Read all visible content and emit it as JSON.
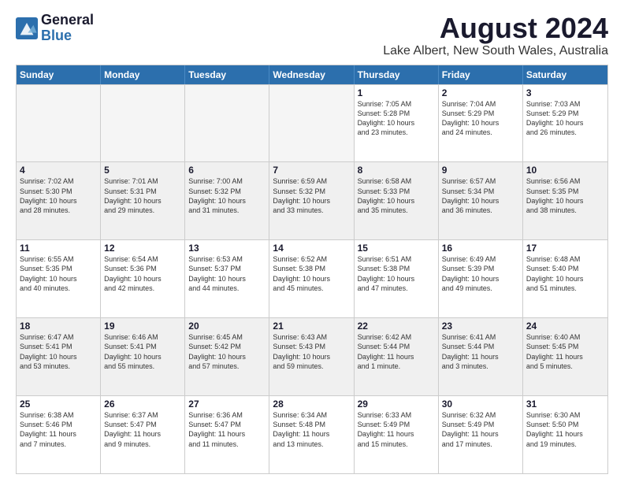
{
  "header": {
    "logo_general": "General",
    "logo_blue": "Blue",
    "title": "August 2024",
    "subtitle": "Lake Albert, New South Wales, Australia"
  },
  "weekdays": [
    "Sunday",
    "Monday",
    "Tuesday",
    "Wednesday",
    "Thursday",
    "Friday",
    "Saturday"
  ],
  "rows": [
    [
      {
        "day": "",
        "empty": true
      },
      {
        "day": "",
        "empty": true
      },
      {
        "day": "",
        "empty": true
      },
      {
        "day": "",
        "empty": true
      },
      {
        "day": "1",
        "info": "Sunrise: 7:05 AM\nSunset: 5:28 PM\nDaylight: 10 hours\nand 23 minutes."
      },
      {
        "day": "2",
        "info": "Sunrise: 7:04 AM\nSunset: 5:29 PM\nDaylight: 10 hours\nand 24 minutes."
      },
      {
        "day": "3",
        "info": "Sunrise: 7:03 AM\nSunset: 5:29 PM\nDaylight: 10 hours\nand 26 minutes."
      }
    ],
    [
      {
        "day": "4",
        "info": "Sunrise: 7:02 AM\nSunset: 5:30 PM\nDaylight: 10 hours\nand 28 minutes."
      },
      {
        "day": "5",
        "info": "Sunrise: 7:01 AM\nSunset: 5:31 PM\nDaylight: 10 hours\nand 29 minutes."
      },
      {
        "day": "6",
        "info": "Sunrise: 7:00 AM\nSunset: 5:32 PM\nDaylight: 10 hours\nand 31 minutes."
      },
      {
        "day": "7",
        "info": "Sunrise: 6:59 AM\nSunset: 5:32 PM\nDaylight: 10 hours\nand 33 minutes."
      },
      {
        "day": "8",
        "info": "Sunrise: 6:58 AM\nSunset: 5:33 PM\nDaylight: 10 hours\nand 35 minutes."
      },
      {
        "day": "9",
        "info": "Sunrise: 6:57 AM\nSunset: 5:34 PM\nDaylight: 10 hours\nand 36 minutes."
      },
      {
        "day": "10",
        "info": "Sunrise: 6:56 AM\nSunset: 5:35 PM\nDaylight: 10 hours\nand 38 minutes."
      }
    ],
    [
      {
        "day": "11",
        "info": "Sunrise: 6:55 AM\nSunset: 5:35 PM\nDaylight: 10 hours\nand 40 minutes."
      },
      {
        "day": "12",
        "info": "Sunrise: 6:54 AM\nSunset: 5:36 PM\nDaylight: 10 hours\nand 42 minutes."
      },
      {
        "day": "13",
        "info": "Sunrise: 6:53 AM\nSunset: 5:37 PM\nDaylight: 10 hours\nand 44 minutes."
      },
      {
        "day": "14",
        "info": "Sunrise: 6:52 AM\nSunset: 5:38 PM\nDaylight: 10 hours\nand 45 minutes."
      },
      {
        "day": "15",
        "info": "Sunrise: 6:51 AM\nSunset: 5:38 PM\nDaylight: 10 hours\nand 47 minutes."
      },
      {
        "day": "16",
        "info": "Sunrise: 6:49 AM\nSunset: 5:39 PM\nDaylight: 10 hours\nand 49 minutes."
      },
      {
        "day": "17",
        "info": "Sunrise: 6:48 AM\nSunset: 5:40 PM\nDaylight: 10 hours\nand 51 minutes."
      }
    ],
    [
      {
        "day": "18",
        "info": "Sunrise: 6:47 AM\nSunset: 5:41 PM\nDaylight: 10 hours\nand 53 minutes."
      },
      {
        "day": "19",
        "info": "Sunrise: 6:46 AM\nSunset: 5:41 PM\nDaylight: 10 hours\nand 55 minutes."
      },
      {
        "day": "20",
        "info": "Sunrise: 6:45 AM\nSunset: 5:42 PM\nDaylight: 10 hours\nand 57 minutes."
      },
      {
        "day": "21",
        "info": "Sunrise: 6:43 AM\nSunset: 5:43 PM\nDaylight: 10 hours\nand 59 minutes."
      },
      {
        "day": "22",
        "info": "Sunrise: 6:42 AM\nSunset: 5:44 PM\nDaylight: 11 hours\nand 1 minute."
      },
      {
        "day": "23",
        "info": "Sunrise: 6:41 AM\nSunset: 5:44 PM\nDaylight: 11 hours\nand 3 minutes."
      },
      {
        "day": "24",
        "info": "Sunrise: 6:40 AM\nSunset: 5:45 PM\nDaylight: 11 hours\nand 5 minutes."
      }
    ],
    [
      {
        "day": "25",
        "info": "Sunrise: 6:38 AM\nSunset: 5:46 PM\nDaylight: 11 hours\nand 7 minutes."
      },
      {
        "day": "26",
        "info": "Sunrise: 6:37 AM\nSunset: 5:47 PM\nDaylight: 11 hours\nand 9 minutes."
      },
      {
        "day": "27",
        "info": "Sunrise: 6:36 AM\nSunset: 5:47 PM\nDaylight: 11 hours\nand 11 minutes."
      },
      {
        "day": "28",
        "info": "Sunrise: 6:34 AM\nSunset: 5:48 PM\nDaylight: 11 hours\nand 13 minutes."
      },
      {
        "day": "29",
        "info": "Sunrise: 6:33 AM\nSunset: 5:49 PM\nDaylight: 11 hours\nand 15 minutes."
      },
      {
        "day": "30",
        "info": "Sunrise: 6:32 AM\nSunset: 5:49 PM\nDaylight: 11 hours\nand 17 minutes."
      },
      {
        "day": "31",
        "info": "Sunrise: 6:30 AM\nSunset: 5:50 PM\nDaylight: 11 hours\nand 19 minutes."
      }
    ]
  ]
}
